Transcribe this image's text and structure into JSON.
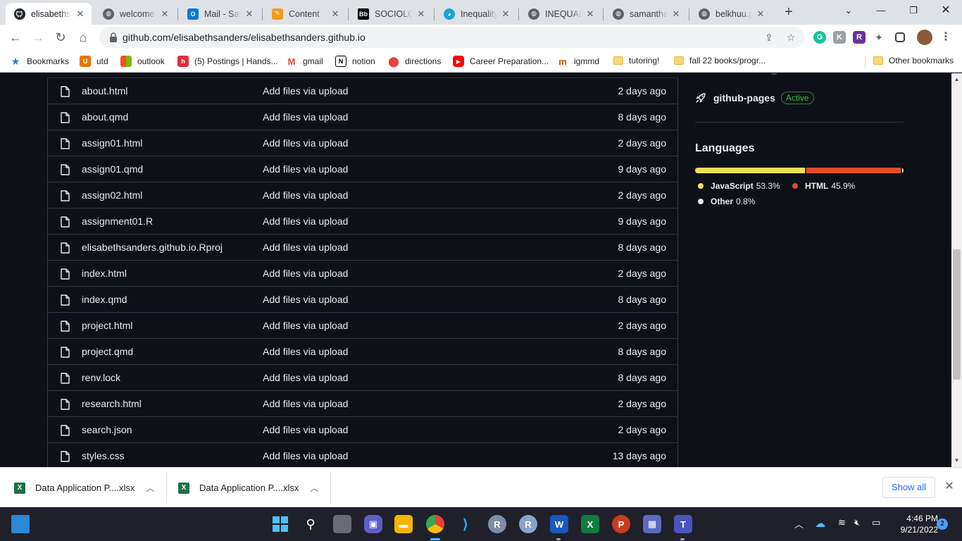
{
  "browser": {
    "tabs": [
      {
        "title": "elisabethsanders",
        "active": true,
        "icon": "github-icon"
      },
      {
        "title": "welcome to",
        "icon": "globe-icon"
      },
      {
        "title": "Mail - Sanders",
        "icon": "outlook-icon"
      },
      {
        "title": "Content",
        "icon": "pencil-icon"
      },
      {
        "title": "SOCIOLOGY",
        "icon": "blackboard-icon"
      },
      {
        "title": "Inequality",
        "icon": "chat-icon"
      },
      {
        "title": "INEQUALITY",
        "icon": "globe-icon"
      },
      {
        "title": "samantha-",
        "icon": "globe-icon"
      },
      {
        "title": "belkhuu.github",
        "icon": "globe-icon"
      }
    ],
    "url": "github.com/elisabethsanders/elisabethsanders.github.io",
    "bookmarks": [
      {
        "label": "Bookmarks",
        "icon": "star-icon"
      },
      {
        "label": "utd",
        "icon": "utd-icon"
      },
      {
        "label": "outlook",
        "icon": "microsoft-icon"
      },
      {
        "label": "(5) Postings | Hands...",
        "icon": "handshake-icon"
      },
      {
        "label": "gmail",
        "icon": "gmail-icon"
      },
      {
        "label": "notion",
        "icon": "notion-icon"
      },
      {
        "label": "directions",
        "icon": "maps-pin-icon"
      },
      {
        "label": "Career Preparation...",
        "icon": "youtube-icon"
      },
      {
        "label": "igmmd",
        "icon": "m-icon"
      },
      {
        "label": "tutoring!",
        "icon": "folder-icon"
      },
      {
        "label": "fall 22 books/progr...",
        "icon": "folder-icon"
      }
    ],
    "other_bookmarks": "Other bookmarks"
  },
  "files": [
    {
      "name": "about.html",
      "message": "Add files via upload",
      "age": "2 days ago"
    },
    {
      "name": "about.qmd",
      "message": "Add files via upload",
      "age": "8 days ago"
    },
    {
      "name": "assign01.html",
      "message": "Add files via upload",
      "age": "2 days ago"
    },
    {
      "name": "assign01.qmd",
      "message": "Add files via upload",
      "age": "9 days ago"
    },
    {
      "name": "assign02.html",
      "message": "Add files via upload",
      "age": "2 days ago"
    },
    {
      "name": "assignment01.R",
      "message": "Add files via upload",
      "age": "9 days ago"
    },
    {
      "name": "elisabethsanders.github.io.Rproj",
      "message": "Add files via upload",
      "age": "8 days ago"
    },
    {
      "name": "index.html",
      "message": "Add files via upload",
      "age": "2 days ago"
    },
    {
      "name": "index.qmd",
      "message": "Add files via upload",
      "age": "8 days ago"
    },
    {
      "name": "project.html",
      "message": "Add files via upload",
      "age": "2 days ago"
    },
    {
      "name": "project.qmd",
      "message": "Add files via upload",
      "age": "8 days ago"
    },
    {
      "name": "renv.lock",
      "message": "Add files via upload",
      "age": "8 days ago"
    },
    {
      "name": "research.html",
      "message": "Add files via upload",
      "age": "2 days ago"
    },
    {
      "name": "search.json",
      "message": "Add files via upload",
      "age": "2 days ago"
    },
    {
      "name": "styles.css",
      "message": "Add files via upload",
      "age": "13 days ago"
    }
  ],
  "sidebar": {
    "environment_name": "github-pages",
    "environment_status": "Active",
    "languages_heading": "Languages",
    "languages": [
      {
        "name": "JavaScript",
        "percent": "53.3%",
        "value": 53.3,
        "color": "#f1e05a"
      },
      {
        "name": "HTML",
        "percent": "45.9%",
        "value": 45.9,
        "color": "#e34c26"
      },
      {
        "name": "Other",
        "percent": "0.8%",
        "value": 0.8,
        "color": "#ededed"
      }
    ]
  },
  "downloads": {
    "items": [
      {
        "name": "Data Application P....xlsx"
      },
      {
        "name": "Data Application P....xlsx"
      }
    ],
    "show_all": "Show all"
  },
  "taskbar": {
    "time": "4:46 PM",
    "date": "9/21/2022",
    "notification_count": "2"
  }
}
